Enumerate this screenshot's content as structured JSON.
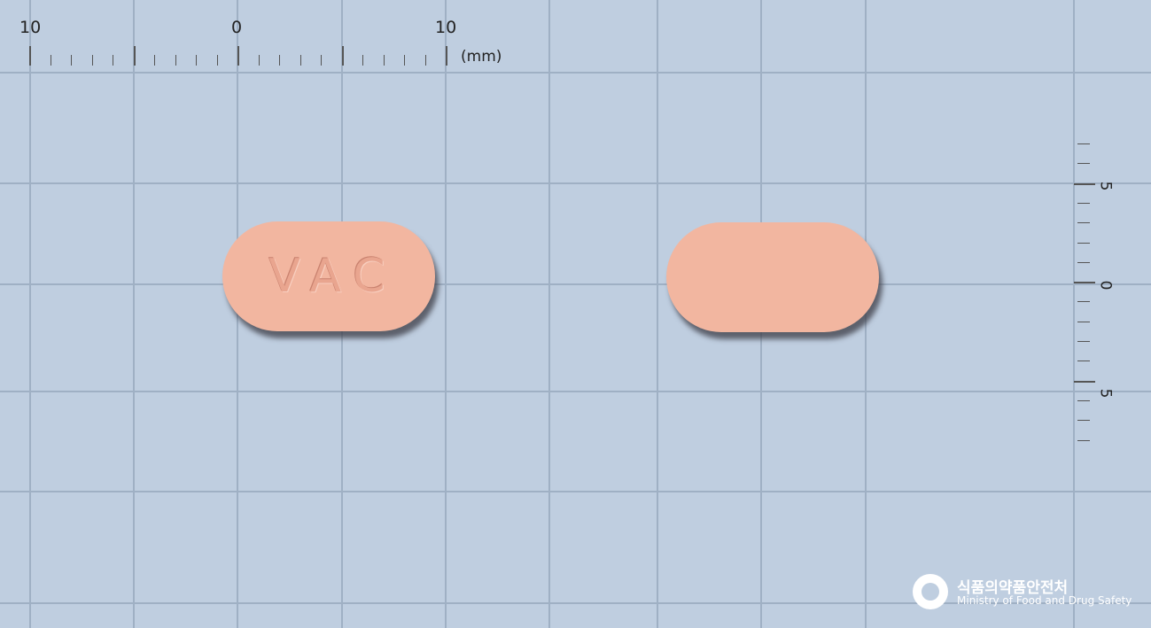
{
  "ruler_top": {
    "labels": [
      "10",
      "0",
      "10"
    ],
    "unit": "(mm)"
  },
  "ruler_right": {
    "labels": [
      "5",
      "0",
      "5"
    ]
  },
  "tablets": [
    {
      "name": "front",
      "imprint": "VAC",
      "color": "#f2b6a0"
    },
    {
      "name": "back",
      "imprint": "",
      "color": "#f2b6a0"
    }
  ],
  "watermark": {
    "org_korean": "식품의약품안전처",
    "org_english": "Ministry of Food and Drug Safety",
    "logo": "mfds-logo-icon"
  },
  "colors": {
    "background": "#bfcee0",
    "grid": "#9fb0c4",
    "tablet": "#f2b6a0"
  }
}
